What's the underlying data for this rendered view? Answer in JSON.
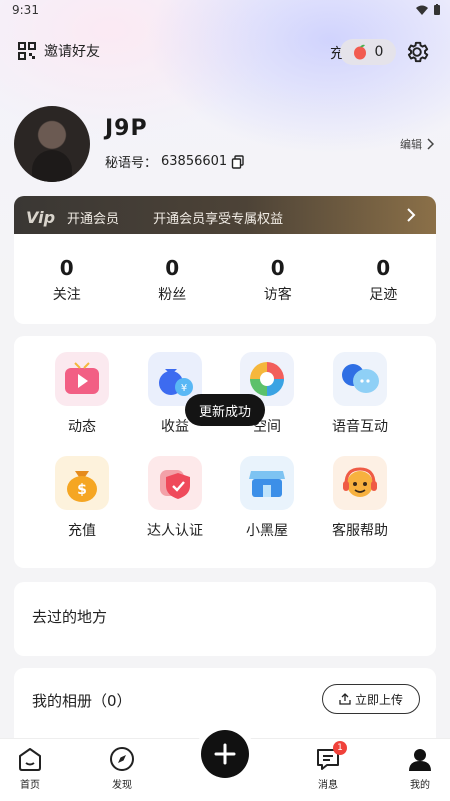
{
  "status_bar": {
    "time": "9:31"
  },
  "header": {
    "invite_label": "邀请好友",
    "recharge_label": "充值",
    "coin_count": "0"
  },
  "profile": {
    "username": "J9P",
    "id_label": "秘语号：",
    "id_value": "63856601",
    "edit_label": "编辑"
  },
  "vip": {
    "logo": "Vip",
    "label": "开通会员",
    "description": "开通会员享受专属权益"
  },
  "stats": [
    {
      "value": "0",
      "label": "关注"
    },
    {
      "value": "0",
      "label": "粉丝"
    },
    {
      "value": "0",
      "label": "访客"
    },
    {
      "value": "0",
      "label": "足迹"
    }
  ],
  "features": [
    {
      "label": "动态",
      "icon": "video-play-icon"
    },
    {
      "label": "收益",
      "icon": "money-bag-icon"
    },
    {
      "label": "空间",
      "icon": "aperture-icon"
    },
    {
      "label": "语音互动",
      "icon": "chat-bubble-icon"
    },
    {
      "label": "充值",
      "icon": "coin-bag-icon"
    },
    {
      "label": "达人认证",
      "icon": "shield-badge-icon"
    },
    {
      "label": "小黑屋",
      "icon": "shop-icon"
    },
    {
      "label": "客服帮助",
      "icon": "headset-icon"
    }
  ],
  "toast": "更新成功",
  "places": {
    "title": "去过的地方"
  },
  "album": {
    "title": "我的相册（0）",
    "upload_label": "立即上传"
  },
  "tabbar": {
    "home": "首页",
    "discover": "发现",
    "messages": "消息",
    "messages_badge": "1",
    "mine": "我的"
  },
  "colors": {
    "accent": "#f0413a",
    "vip_bg": "#3a3734",
    "vip_gold": "#8b7048"
  }
}
